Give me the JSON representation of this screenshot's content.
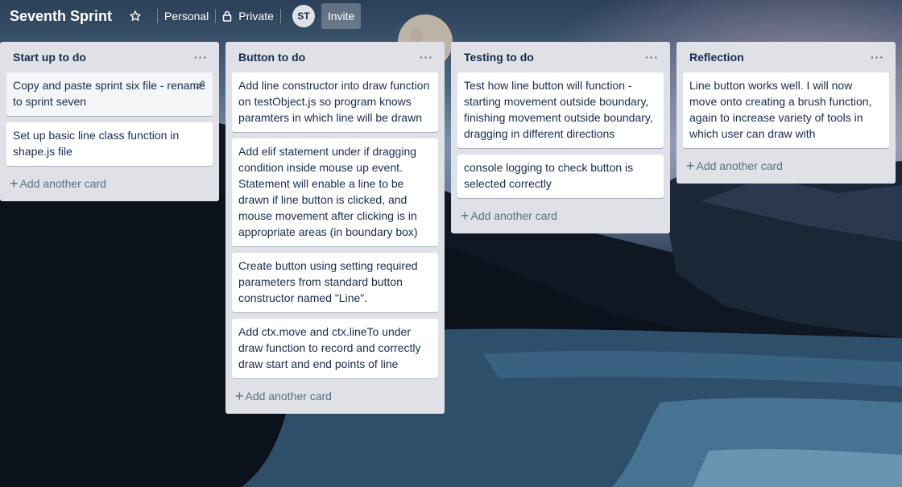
{
  "header": {
    "board_title": "Seventh Sprint",
    "team_label": "Personal",
    "visibility_label": "Private",
    "member_initials": "ST",
    "invite_label": "Invite"
  },
  "lists": [
    {
      "title": "Start up to do",
      "menu": "···",
      "cards": [
        "Copy and paste sprint six file - rename to sprint seven",
        "Set up basic line class function in shape.js file"
      ],
      "add_card_label": "Add another card"
    },
    {
      "title": "Button to do",
      "menu": "···",
      "cards": [
        "Add line constructor into draw function on testObject.js so program knows paramters in which line will be drawn",
        "Add elif statement under if dragging condition inside mouse up event. Statement will enable a line to be drawn if line button is clicked, and mouse movement after clicking is in appropriate areas (in boundary box)",
        "Create button using setting required parameters from standard button constructor named \"Line\".",
        "Add ctx.move and ctx.lineTo under draw function to record and correctly draw start and end points of line"
      ],
      "add_card_label": "Add another card"
    },
    {
      "title": "Testing to do",
      "menu": "···",
      "cards": [
        "Test how line button will function - starting movement outside boundary, finishing movement outside boundary, dragging in different directions",
        "console logging to check button is selected correctly"
      ],
      "add_card_label": "Add another card"
    },
    {
      "title": "Reflection",
      "menu": "···",
      "cards": [
        "Line button works well. I will now move onto creating a brush function, again to increase variety of tools in which user can draw with"
      ],
      "add_card_label": "Add another card"
    }
  ]
}
